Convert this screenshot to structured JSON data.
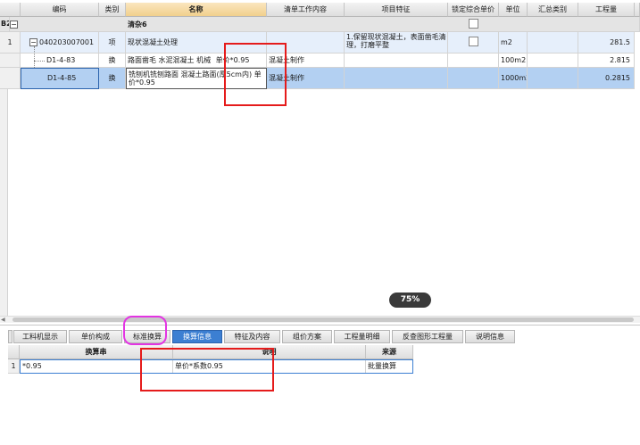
{
  "upper_table": {
    "columns": [
      "编码",
      "类别",
      "名称",
      "清单工作内容",
      "项目特征",
      "锁定综合单价",
      "单位",
      "汇总类别",
      "工程量"
    ],
    "group_row": {
      "code": "B2",
      "toggle": "−",
      "name": "清杂6"
    },
    "item_row": {
      "index": "1",
      "toggle": "−",
      "code": "040203007001",
      "type": "项",
      "name": "现状混凝土处理",
      "feature": "1.保留现状混凝土，表面凿毛清理，打磨平整",
      "unit": "m2",
      "quantity": "281.5"
    },
    "sub_rows": [
      {
        "code": "D1-4-83",
        "type": "换",
        "name": "路面凿毛 水泥混凝土 机械",
        "name_suffix": "单价*0.95",
        "content": "混凝土制作",
        "unit": "100m2",
        "quantity": "2.815"
      },
      {
        "code": "D1-4-85",
        "type": "换",
        "name": "铣刨机铣刨路面 混凝土路面(厚5cm内) 单价*0.95",
        "content": "混凝土制作",
        "unit": "1000m2",
        "quantity": "0.2815"
      }
    ]
  },
  "zoom_label": "75%",
  "bottom_tabs": [
    "工料机显示",
    "单价构成",
    "标准换算",
    "换算信息",
    "特征及内容",
    "组价方案",
    "工程量明细",
    "反查图形工程量",
    "说明信息"
  ],
  "active_tab": "换算信息",
  "lower_table": {
    "columns": [
      "换算串",
      "说明",
      "来源"
    ],
    "rows": [
      {
        "index": "1",
        "string": "*0.95",
        "description": "单价*系数0.95",
        "source": "批量换算"
      }
    ]
  },
  "colors": {
    "selected_row": "#b3d0f2",
    "item_row": "#e6effb",
    "accent": "#3c7fd2",
    "annotation_red": "#e51b1b",
    "annotation_pink": "#e335e3"
  }
}
